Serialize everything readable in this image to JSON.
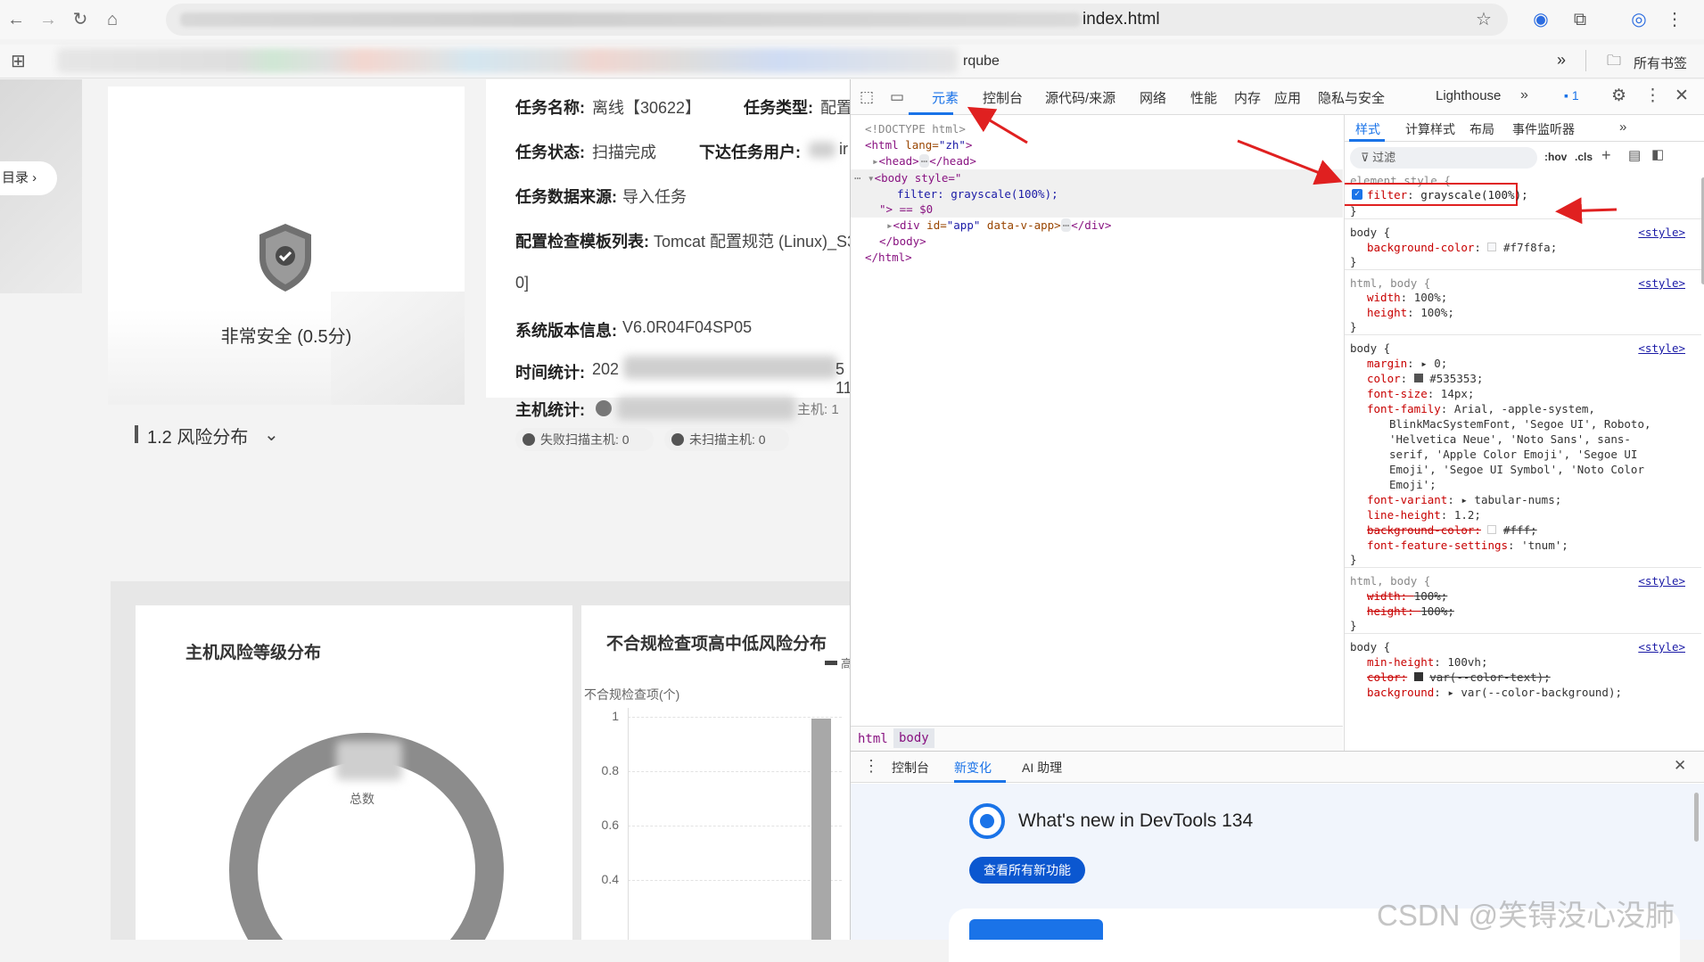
{
  "browser": {
    "url_tail": "index.html",
    "bookmark_visible": "rqube",
    "all_bookmarks": "所有书签"
  },
  "page": {
    "side_toc": "目录",
    "score_text": "非常安全 (0.5分)",
    "task_name_label": "任务名称:",
    "task_name_value": "离线【30622】",
    "task_type_label": "任务类型:",
    "task_type_value": "配置",
    "task_status_label": "任务状态:",
    "task_status_value": "扫描完成",
    "issuer_label": "下达任务用户:",
    "issuer_value": "ir",
    "data_source_label": "任务数据来源:",
    "data_source_value": "导入任务",
    "template_label": "配置检查模板列表:",
    "template_value": "Tomcat 配置规范 (Linux)_S3",
    "template_value_cont": "0]",
    "sys_version_label": "系统版本信息:",
    "sys_version_value": "V6.0R04F04SP05",
    "time_label": "时间统计:",
    "time_value_start": "202",
    "time_value_end": "5 11",
    "host_label": "主机统计:",
    "host_partial": "主机: 1",
    "fail_hosts": "失败扫描主机: 0",
    "unscanned_hosts": "未扫描主机: 0",
    "section_title": "1.2 风险分布",
    "chart1_title": "主机风险等级分布",
    "donut_center_label": "总数",
    "chart2_title": "不合规检查项高中低风险分布",
    "chart2_ylabel": "不合规检查项(个)",
    "chart2_legend_mark": "高",
    "chart2_ticks": [
      "1",
      "0.8",
      "0.6",
      "0.4"
    ]
  },
  "devtools": {
    "tabs": [
      "元素",
      "控制台",
      "源代码/来源",
      "网络",
      "性能",
      "内存",
      "应用",
      "隐私与安全",
      "Lighthouse"
    ],
    "issues_count": "1",
    "dom": {
      "doctype": "<!DOCTYPE html>",
      "html_open_tag": "<html",
      "html_lang_attr": "lang=",
      "html_lang_val": "\"zh\"",
      "head": "<head>",
      "head_close": "</head>",
      "body_open": "<body style=\"",
      "body_style": "filter: grayscale(100%);",
      "body_close_quote": "\"> == $0",
      "div_open": "<div",
      "div_id_attr": "id=",
      "div_id_val": "\"app\"",
      "div_vapp": "data-v-app>",
      "div_close": "</div>",
      "body_close": "</body>",
      "html_close": "</html>"
    },
    "breadcrumb": [
      "html",
      "body"
    ],
    "styles_tabs": [
      "样式",
      "计算样式",
      "布局",
      "事件监听器"
    ],
    "filter_placeholder": "过滤",
    "hov": ":hov",
    "cls": ".cls",
    "rules": {
      "element_style_selector": "element.style {",
      "element_style_prop": "filter",
      "element_style_val": "grayscale(100%);",
      "r1_sel": "body {",
      "r1_src": "<style>",
      "r1_p1": "background-color",
      "r1_v1": "#f7f8fa;",
      "r2_sel": "html, body {",
      "r2_src": "<style>",
      "r2_p1": "width",
      "r2_v1": "100%;",
      "r2_p2": "height",
      "r2_v2": "100%;",
      "r3_sel": "body {",
      "r3_src": "<style>",
      "r3_margin": "0;",
      "r3_color": "#535353;",
      "r3_fontsize": "14px;",
      "r3_family_1": "Arial, -apple-system,",
      "r3_family_2": "BlinkMacSystemFont, 'Segoe UI', Roboto,",
      "r3_family_3": "'Helvetica Neue', 'Noto Sans', sans-",
      "r3_family_4": "serif, 'Apple Color Emoji', 'Segoe UI",
      "r3_family_5": "Emoji', 'Segoe UI Symbol', 'Noto Color",
      "r3_family_6": "Emoji';",
      "r3_variant": "tabular-nums;",
      "r3_lh": "1.2;",
      "r3_bg_struck": "#fff;",
      "r3_ffs": "'tnum';",
      "r4_sel": "html, body {",
      "r4_src": "<style>",
      "r4_w": "100%;",
      "r4_h": "100%;",
      "r5_sel": "body {",
      "r5_src": "<style>",
      "r5_minh": "100vh;",
      "r5_color": "var(--color-text);",
      "r5_bg": "var(--color-background);"
    },
    "drawer_tabs": [
      "控制台",
      "新变化",
      "AI 助理"
    ],
    "whats_new_title": "What's new in DevTools 134",
    "whats_new_button": "查看所有新功能"
  },
  "watermark": "CSDN @笑锝没心没肺"
}
